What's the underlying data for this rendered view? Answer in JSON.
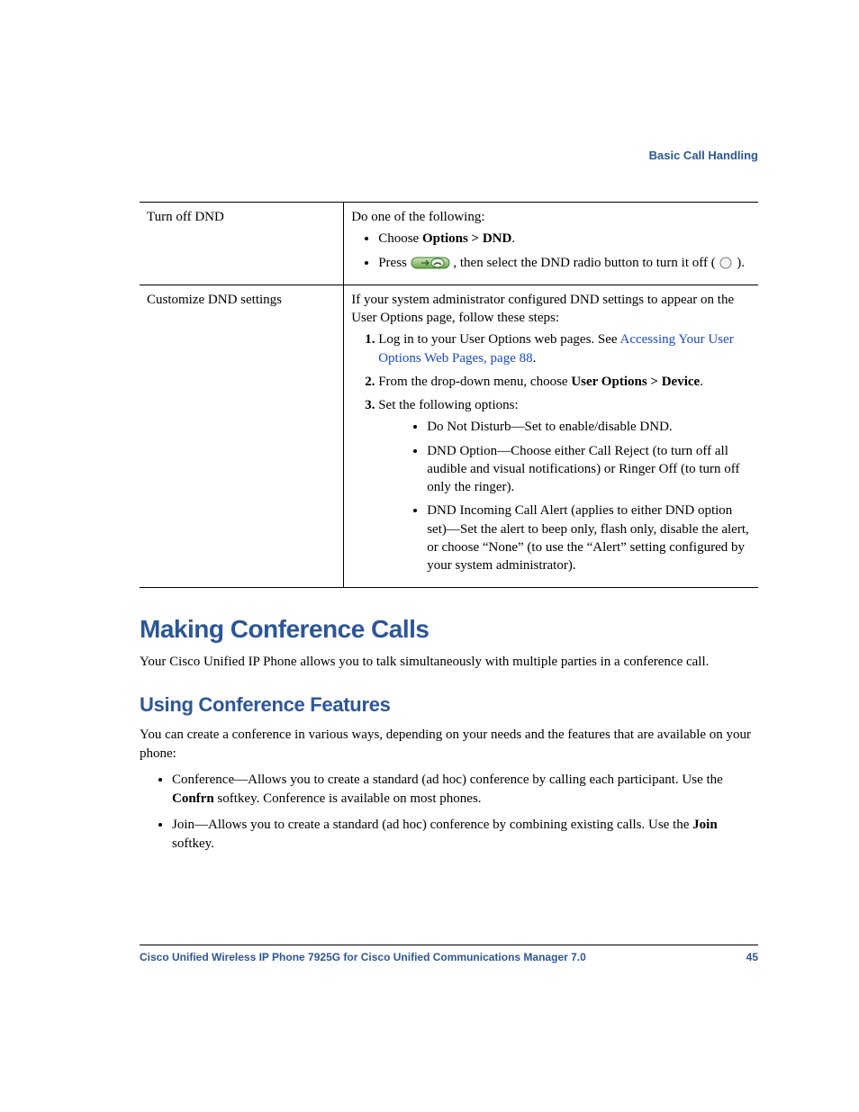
{
  "header": {
    "breadcrumb": "Basic Call Handling"
  },
  "table": {
    "row1": {
      "label": "Turn off DND",
      "intro": "Do one of the following:",
      "bullet1_pre": "Choose ",
      "bullet1_bold": "Options > DND",
      "bullet1_post": ".",
      "bullet2_pre": "Press ",
      "bullet2_mid": " , then select the DND radio button to turn it off ( ",
      "bullet2_post": " )."
    },
    "row2": {
      "label": "Customize DND settings",
      "intro": "If your system administrator configured DND settings to appear on the User Options page, follow these steps:",
      "step1_pre": "Log in to your User Options web pages. See ",
      "step1_link": "Accessing Your User Options Web Pages, page 88",
      "step1_post": ".",
      "step2_pre": "From the drop-down menu, choose ",
      "step2_bold": "User Options > Device",
      "step2_post": ".",
      "step3": "Set the following options:",
      "sub1": "Do Not Disturb—Set to enable/disable DND.",
      "sub2": "DND Option—Choose either Call Reject (to turn off all audible and visual notifications) or Ringer Off (to turn off only the ringer).",
      "sub3": "DND Incoming Call Alert (applies to either DND option set)—Set the alert to beep only, flash only, disable the alert, or choose “None” (to use the “Alert” setting configured by your system administrator)."
    }
  },
  "sections": {
    "h1": "Making Conference Calls",
    "p1": "Your Cisco Unified IP Phone allows you to talk simultaneously with multiple parties in a conference call.",
    "h2": "Using Conference Features",
    "p2": "You can create a conference in various ways, depending on your needs and the features that are available on your phone:",
    "li1_pre": "Conference—Allows you to create a standard (ad hoc) conference by calling each participant. Use the ",
    "li1_bold": "Confrn",
    "li1_post": " softkey. Conference is available on most phones.",
    "li2_pre": "Join—Allows you to create a standard (ad hoc) conference by combining existing calls. Use the ",
    "li2_bold": "Join",
    "li2_post": " softkey."
  },
  "footer": {
    "title": "Cisco Unified Wireless IP Phone 7925G for Cisco Unified Communications Manager 7.0",
    "page": "45"
  }
}
